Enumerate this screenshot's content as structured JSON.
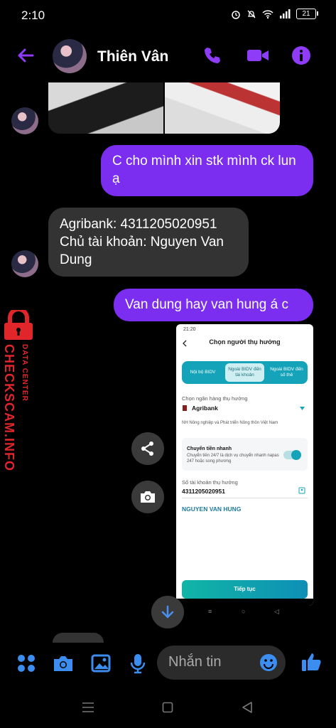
{
  "status_bar": {
    "time": "2:10",
    "battery": "21"
  },
  "header": {
    "contact_name": "Thiên Vân"
  },
  "messages": {
    "out1": "C cho mình xin stk mình ck lun ạ",
    "in1": "Agribank: 4311205020951 Chủ tài khoản: Nguyen Van Dung",
    "out2": "Van dung hay van hung á c"
  },
  "watermark": {
    "line1": "DATA CENTER",
    "line2": "CHECKSCAM.INFO"
  },
  "screenshot": {
    "time": "21:20",
    "title": "Chọn người thụ hưởng",
    "tabs": [
      "Nội bộ BIDV",
      "Ngoài BIDV đến tài khoản",
      "Ngoài BIDV đến số thẻ"
    ],
    "bank_label": "Chọn ngân hàng thụ hưởng",
    "bank_value": "Agribank",
    "bank_full": "NH Nông nghiệp và Phát triển Nông thôn Việt Nam",
    "fast_title": "Chuyển tiền nhanh",
    "fast_desc": "Chuyển tiền 24/7 là dịch vụ chuyển nhanh napas 247 hoặc song phương",
    "account_label": "Số tài khoản thụ hưởng",
    "account_value": "4311205020951",
    "account_name": "NGUYEN VAN HUNG",
    "continue_button": "Tiếp tục"
  },
  "composer": {
    "placeholder": "Nhắn tin"
  },
  "colors": {
    "accent": "#7b2ef0",
    "incoming": "#333333",
    "watermark": "#e0262a",
    "bidv_teal": "#14a3b8"
  }
}
